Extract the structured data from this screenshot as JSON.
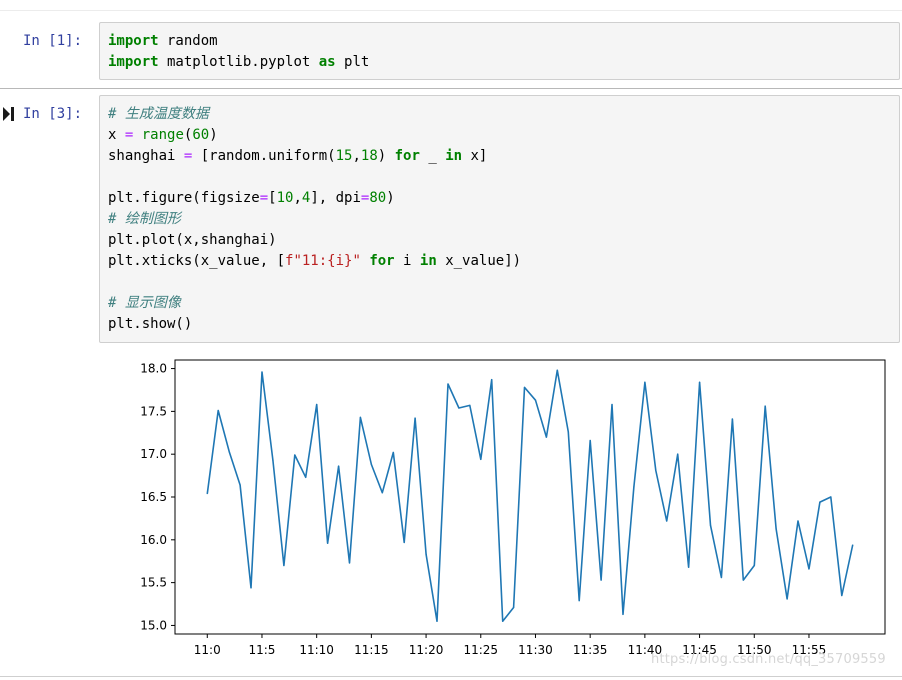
{
  "cell1": {
    "prompt": "In  [1]:",
    "code": [
      [
        {
          "t": "import",
          "c": "kw"
        },
        {
          "t": " random",
          "c": ""
        }
      ],
      [
        {
          "t": "import",
          "c": "kw"
        },
        {
          "t": " matplotlib.pyplot ",
          "c": ""
        },
        {
          "t": "as",
          "c": "kw"
        },
        {
          "t": " plt",
          "c": ""
        }
      ]
    ]
  },
  "cell2": {
    "prompt": "In  [3]:",
    "code": [
      [
        {
          "t": "# 生成温度数据",
          "c": "cm"
        }
      ],
      [
        {
          "t": "x ",
          "c": ""
        },
        {
          "t": "=",
          "c": "op"
        },
        {
          "t": " ",
          "c": ""
        },
        {
          "t": "range",
          "c": "bi"
        },
        {
          "t": "(",
          "c": ""
        },
        {
          "t": "60",
          "c": "num"
        },
        {
          "t": ")",
          "c": ""
        }
      ],
      [
        {
          "t": "shanghai ",
          "c": ""
        },
        {
          "t": "=",
          "c": "op"
        },
        {
          "t": " [random.uniform(",
          "c": ""
        },
        {
          "t": "15",
          "c": "num"
        },
        {
          "t": ",",
          "c": ""
        },
        {
          "t": "18",
          "c": "num"
        },
        {
          "t": ") ",
          "c": ""
        },
        {
          "t": "for",
          "c": "kw"
        },
        {
          "t": " _ ",
          "c": ""
        },
        {
          "t": "in",
          "c": "kw"
        },
        {
          "t": " x]",
          "c": ""
        }
      ],
      [],
      [
        {
          "t": "plt.figure(figsize",
          "c": ""
        },
        {
          "t": "=",
          "c": "op"
        },
        {
          "t": "[",
          "c": ""
        },
        {
          "t": "10",
          "c": "num"
        },
        {
          "t": ",",
          "c": ""
        },
        {
          "t": "4",
          "c": "num"
        },
        {
          "t": "], dpi",
          "c": ""
        },
        {
          "t": "=",
          "c": "op"
        },
        {
          "t": "80",
          "c": "num"
        },
        {
          "t": ")",
          "c": ""
        }
      ],
      [
        {
          "t": "# 绘制图形",
          "c": "cm"
        }
      ],
      [
        {
          "t": "plt.plot(x,shanghai)",
          "c": ""
        }
      ],
      [
        {
          "t": "plt.xticks(x_value, [",
          "c": ""
        },
        {
          "t": "f\"11:{i}\"",
          "c": "str"
        },
        {
          "t": " ",
          "c": ""
        },
        {
          "t": "for",
          "c": "kw"
        },
        {
          "t": " i ",
          "c": ""
        },
        {
          "t": "in",
          "c": "kw"
        },
        {
          "t": " x_value])",
          "c": ""
        }
      ],
      [],
      [
        {
          "t": "# 显示图像",
          "c": "cm"
        }
      ],
      [
        {
          "t": "plt.show()",
          "c": ""
        }
      ]
    ]
  },
  "watermark": "https://blog.csdn.net/qq_35709559",
  "chart_data": {
    "type": "line",
    "x": [
      0,
      1,
      2,
      3,
      4,
      5,
      6,
      7,
      8,
      9,
      10,
      11,
      12,
      13,
      14,
      15,
      16,
      17,
      18,
      19,
      20,
      21,
      22,
      23,
      24,
      25,
      26,
      27,
      28,
      29,
      30,
      31,
      32,
      33,
      34,
      35,
      36,
      37,
      38,
      39,
      40,
      41,
      42,
      43,
      44,
      45,
      46,
      47,
      48,
      49,
      50,
      51,
      52,
      53,
      54,
      55,
      56,
      57,
      58,
      59
    ],
    "values": [
      16.54,
      17.51,
      17.03,
      16.64,
      15.44,
      17.96,
      16.93,
      15.7,
      16.99,
      16.73,
      17.58,
      15.96,
      16.86,
      15.73,
      17.43,
      16.88,
      16.55,
      17.02,
      15.97,
      17.42,
      15.83,
      15.05,
      17.82,
      17.54,
      17.57,
      16.94,
      17.87,
      15.05,
      15.21,
      17.78,
      17.63,
      17.2,
      17.98,
      17.26,
      15.29,
      17.16,
      15.53,
      17.58,
      15.13,
      16.62,
      17.84,
      16.81,
      16.22,
      17.0,
      15.68,
      17.84,
      16.17,
      15.56,
      17.41,
      15.53,
      15.7,
      17.56,
      16.13,
      15.31,
      16.22,
      15.66,
      16.44,
      16.5,
      15.35,
      15.94
    ],
    "xtick_positions": [
      0,
      5,
      10,
      15,
      20,
      25,
      30,
      35,
      40,
      45,
      50,
      55
    ],
    "xtick_labels": [
      "11:0",
      "11:5",
      "11:10",
      "11:15",
      "11:20",
      "11:25",
      "11:30",
      "11:35",
      "11:40",
      "11:45",
      "11:50",
      "11:55"
    ],
    "yticks": [
      15.0,
      15.5,
      16.0,
      16.5,
      17.0,
      17.5,
      18.0
    ],
    "ytick_labels": [
      "15.0",
      "15.5",
      "16.0",
      "16.5",
      "17.0",
      "17.5",
      "18.0"
    ],
    "ylim": [
      14.9,
      18.1
    ],
    "xlim": [
      -2.95,
      61.95
    ],
    "line_color": "#1f77b4",
    "grid": false
  }
}
